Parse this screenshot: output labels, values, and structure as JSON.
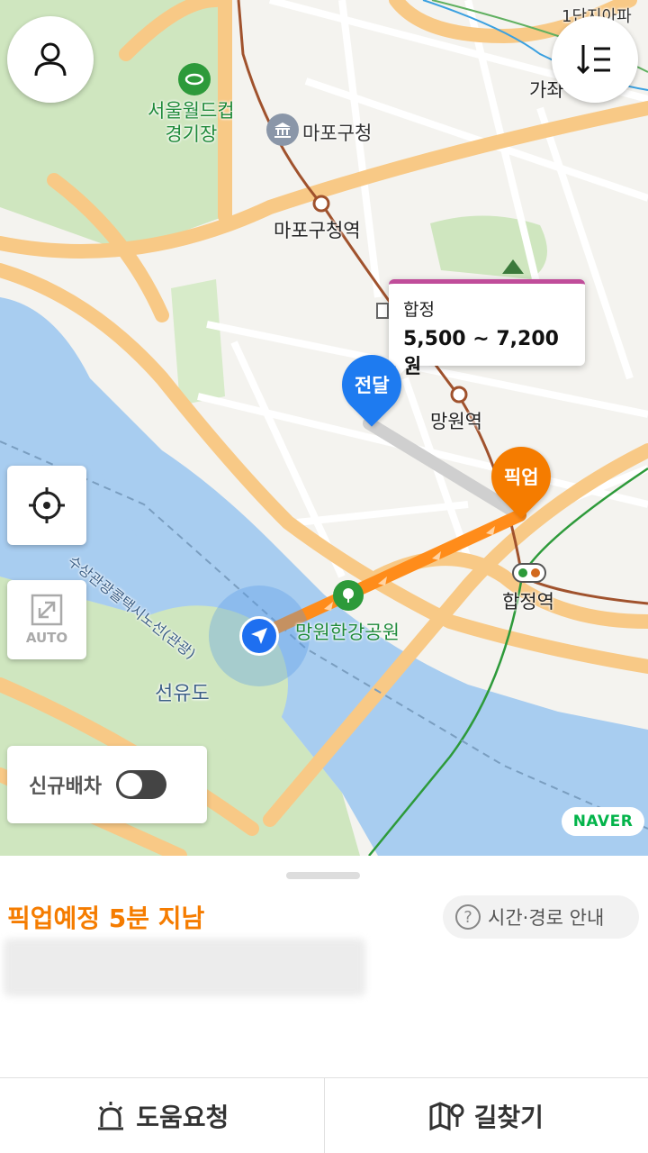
{
  "map": {
    "labels": {
      "world_cup_stadium": "서울월드컵\n경기장",
      "mapo_office": "마포구청",
      "mapo_office_station": "마포구청역",
      "mangwon_station": "망원역",
      "hapjeong_station": "합정역",
      "mangwon_park": "망원한강공원",
      "seonyudo": "선유도",
      "ferry_route": "수상관광콜택시노선(관광)",
      "top_right_partial": "1단지아파",
      "gajwa_partial": "가좌"
    },
    "price_bubble": {
      "place": "합정",
      "price": "5,500 ~ 7,200원"
    },
    "drop_pin_label": "전달",
    "pickup_pin_label": "픽업",
    "auto_label": "AUTO",
    "new_dispatch_label": "신규배차",
    "new_dispatch_on": false,
    "naver_logo": "NAVER",
    "colors": {
      "route_orange": "#ff8c1a",
      "route_gray": "#cfcfcf",
      "pickup_pin": "#f57c00",
      "drop_pin": "#1e7bf0",
      "water": "#a8cdf0",
      "park": "#cfe6bf",
      "road": "#f8c986"
    }
  },
  "sheet": {
    "status": "픽업예정 5분 지남",
    "guide_button": "시간·경로 안내",
    "guide_icon": "?"
  },
  "bottom_bar": {
    "help_label": "도움요청",
    "navigate_label": "길찾기"
  },
  "icons": {
    "profile": "profile-icon",
    "sort": "sort-list-icon",
    "locate": "crosshair-icon",
    "auto": "expand-icon",
    "help": "siren-icon",
    "navigate": "map-route-icon"
  }
}
